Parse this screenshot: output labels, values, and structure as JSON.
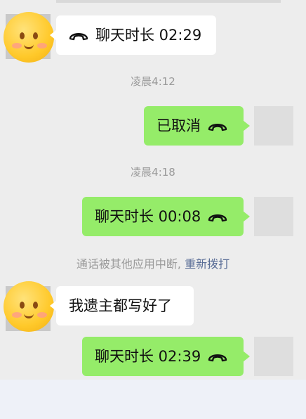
{
  "chat": {
    "msg1": {
      "text": "聊天时长 02:29",
      "icon": "phone-hangup-icon"
    },
    "time1": "凌晨4:12",
    "msg2": {
      "text": "已取消",
      "icon": "phone-hangup-icon"
    },
    "time2": "凌晨4:18",
    "msg3": {
      "text": "聊天时长 00:08",
      "icon": "phone-hangup-icon"
    },
    "system": {
      "text": "通话被其他应用中断,",
      "link": "重新拨打"
    },
    "msg4": {
      "text": "我遗主都写好了"
    },
    "msg5": {
      "text": "聊天时长 02:39",
      "icon": "phone-hangup-icon"
    }
  },
  "colors": {
    "self_bubble": "#95ec69",
    "other_bubble": "#ffffff",
    "link": "#576b95",
    "background": "#ededed"
  }
}
